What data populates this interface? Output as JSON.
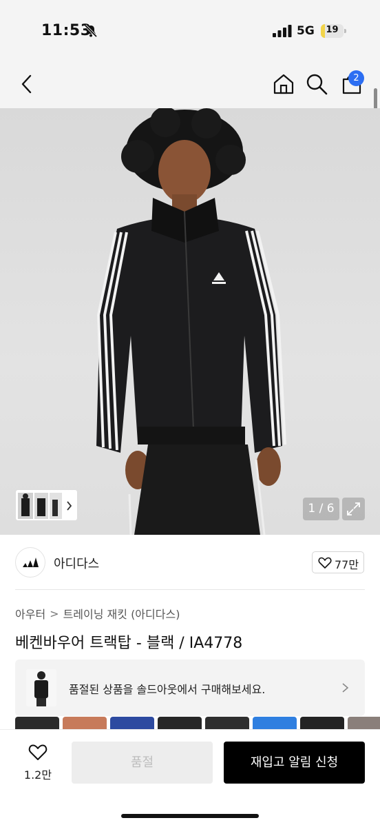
{
  "status_bar": {
    "time": "11:53",
    "network": "5G",
    "battery": "19",
    "battery_level": 0.19,
    "icons": [
      "bell-slash-icon",
      "signal-icon",
      "battery-icon"
    ]
  },
  "nav": {
    "icons": [
      "back-icon",
      "home-icon",
      "search-icon",
      "shopping-bag-icon"
    ],
    "cart_count": "2"
  },
  "gallery": {
    "counter": "1 / 6",
    "expand_icon": "expand-icon",
    "thumbs_chevron_icon": "chevron-right-icon"
  },
  "brand": {
    "name": "아디다스",
    "logo_icon": "adidas-logo-icon",
    "likes": "77만"
  },
  "product": {
    "breadcrumb": [
      "아우터",
      "트레이닝 재킷 (아디다스)"
    ],
    "title": "베켄바우어 트랙탑 - 블랙 / IA4778"
  },
  "soldout_banner": {
    "text": "품절된 상품을 솔드아웃에서 구매해보세요."
  },
  "bottom_bar": {
    "wish_count": "1.2만",
    "soldout_label": "품절",
    "notify_label": "재입고 알림 신청"
  },
  "colors": {
    "accent": "#2c6ef2",
    "primary_button": "#000000",
    "disabled_button": "#ededed"
  }
}
